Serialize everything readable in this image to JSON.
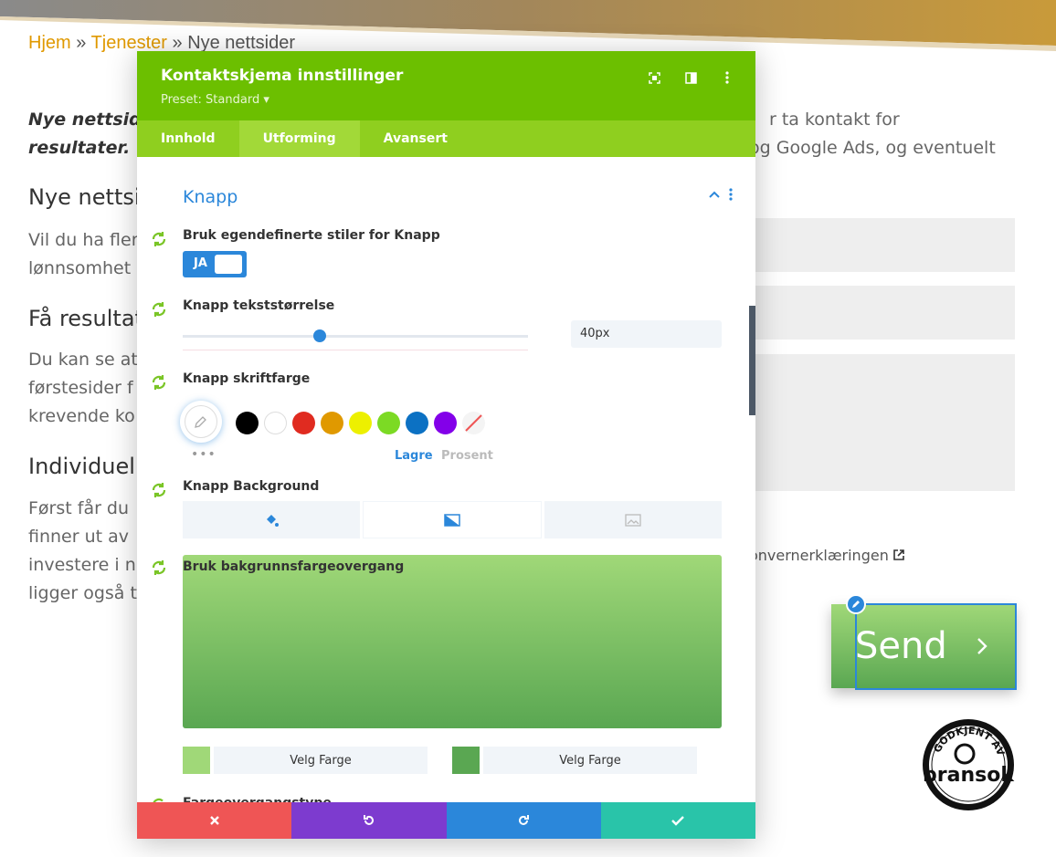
{
  "breadcrumb": [
    "Hjem",
    "Tjenester",
    "Nye nettsider"
  ],
  "breadcrumb_sep": " » ",
  "bg": {
    "intro_a1": "Nye nettside",
    "intro_a2": "resultater.",
    "intro_b1": "r ta kontakt for",
    "intro_b2": "og Google Ads, og eventuelt",
    "h1": "Nye nettsi",
    "p1a": "Vil du ha fler",
    "p1b": "lønnsomhet",
    "h2": "Få resultat",
    "p2a": "Du kan se at",
    "p2b": "førstesider f",
    "p2c": "krevende ko",
    "h3": "Individuel",
    "p3a": "Først får du",
    "p3b": "finner ut av",
    "p3c": "investere i n",
    "p3d": "ligger også t",
    "privacy": "onvernerklæringen",
    "send": "Send"
  },
  "badge": {
    "top": "GODKJENT AV",
    "brand": "bransok"
  },
  "modal": {
    "title": "Kontaktskjema innstillinger",
    "preset": "Preset: Standard",
    "tabs": [
      "Innhold",
      "Utforming",
      "Avansert"
    ],
    "section": {
      "title": "Knapp",
      "opt_custom": "Bruk egendefinerte stiler for Knapp",
      "toggle_value": "JA",
      "opt_size": "Knapp tekststørrelse",
      "size_value": "40px",
      "opt_color": "Knapp skriftfarge",
      "colors_saved": "Lagre",
      "colors_percent": "Prosent",
      "opt_bg": "Knapp Background",
      "opt_gradient": "Bruk bakgrunnsfargeovergang",
      "pick_color": "Velg Farge",
      "opt_grad_type": "Fargeovergangstype"
    },
    "colors": {
      "accent": "#2b87da",
      "header": "#6cbf00",
      "tabs": "#8fcf1f",
      "gradient_start": "#a0d878",
      "gradient_end": "#5aa752",
      "discard": "#ef5555",
      "undo": "#7d3bcf",
      "redo": "#2b87da",
      "save": "#29c4a9"
    },
    "swatches": [
      "#000000",
      "#ffffff",
      "#e02b20",
      "#e09900",
      "#edf000",
      "#7cda24",
      "#0c71c3",
      "#8300e9",
      "none"
    ]
  }
}
